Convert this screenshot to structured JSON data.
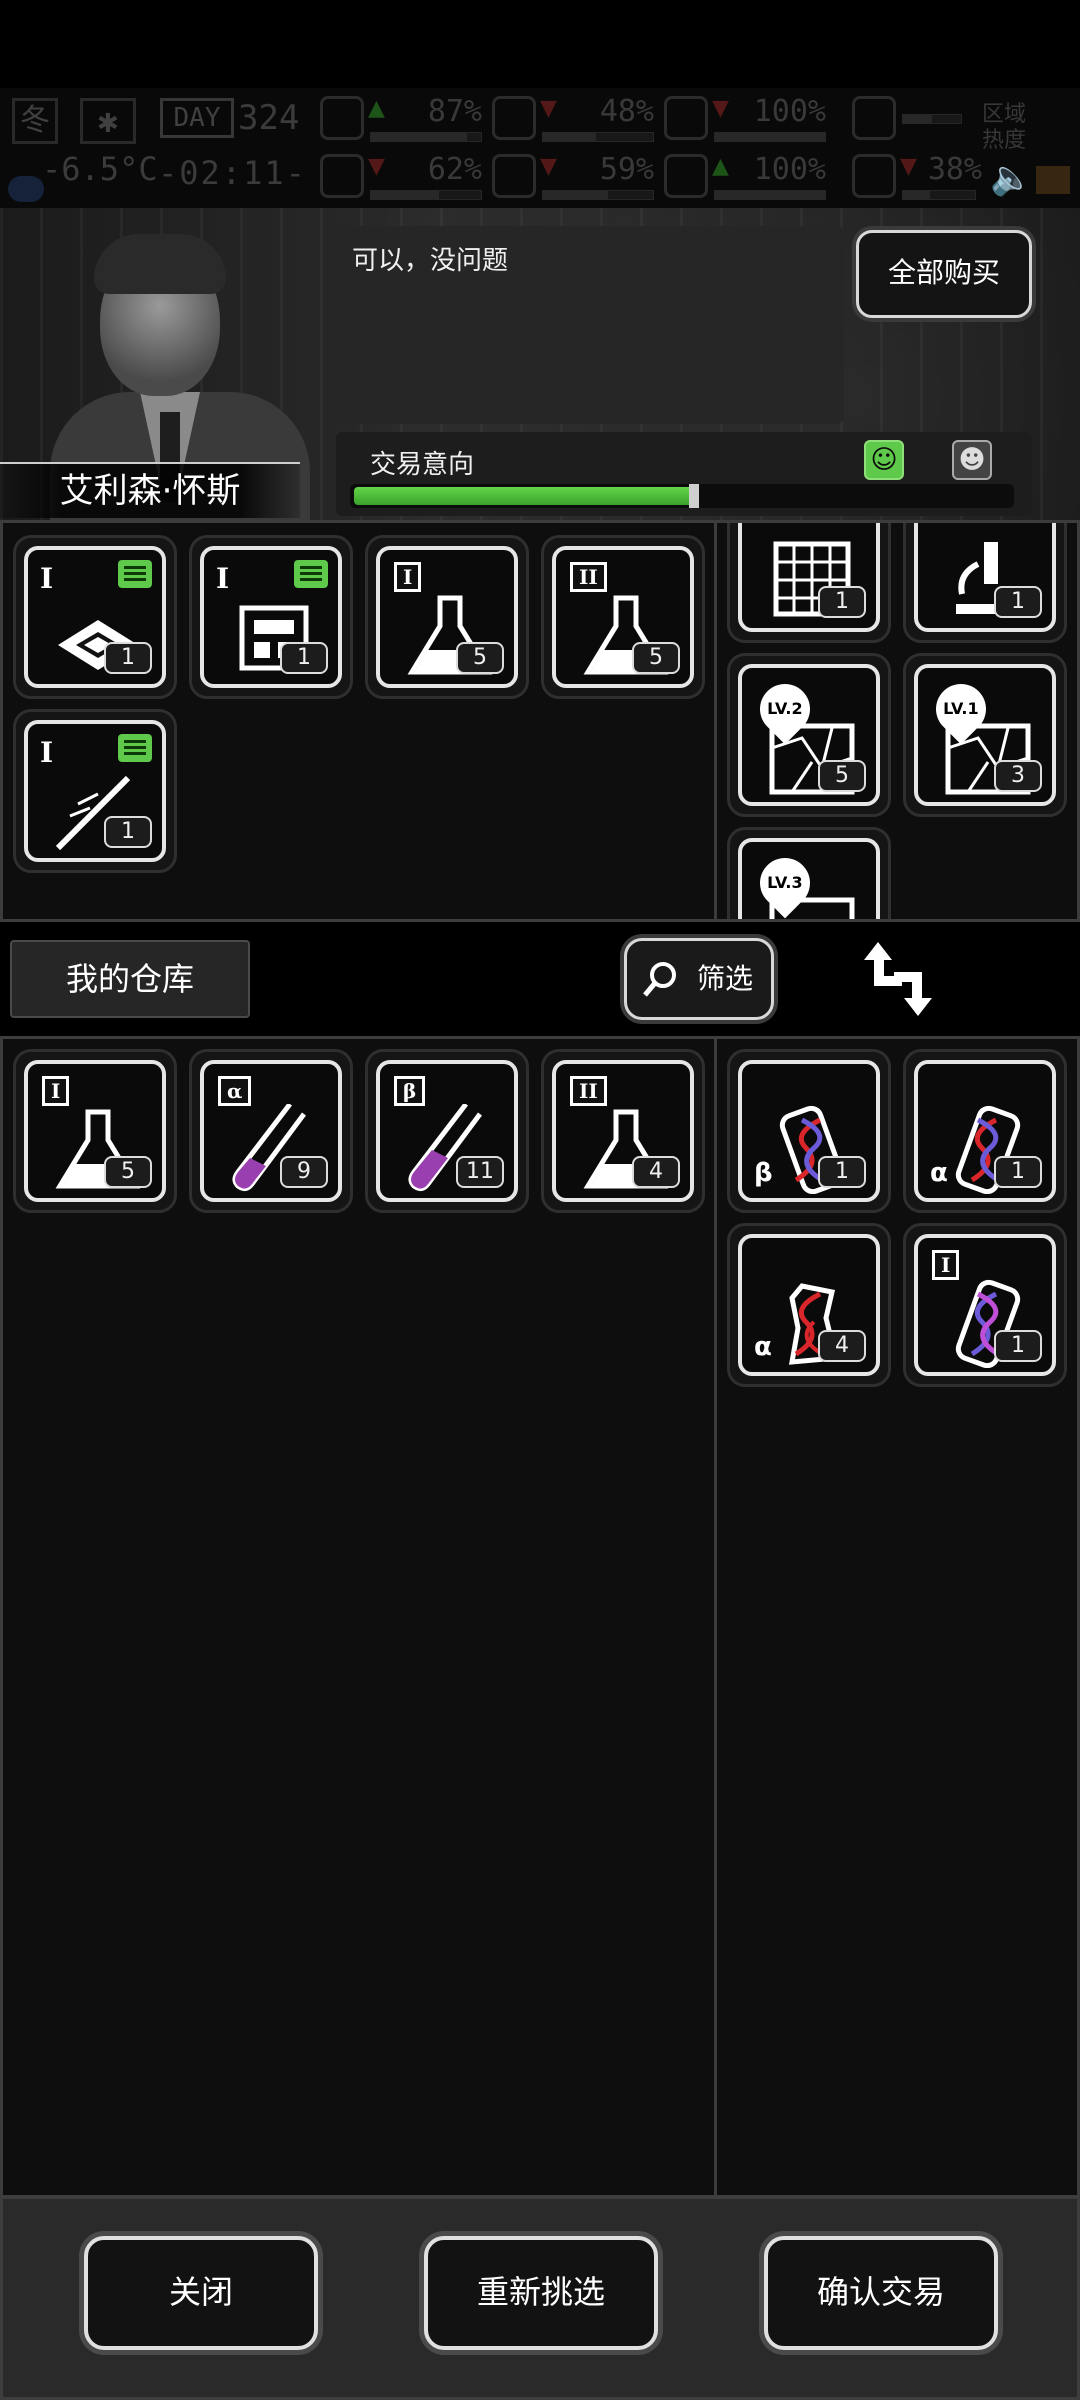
{
  "status": {
    "season": "冬",
    "snow_icon": "snowflake-icon",
    "day_label": "DAY",
    "day_number": "324",
    "temperature": "-6.5°C",
    "time": "-02:11-",
    "stats": [
      {
        "icon": "medkit-icon",
        "value": "87%",
        "trend": "up",
        "level": 0.87
      },
      {
        "icon": "stomach-icon",
        "value": "48%",
        "trend": "down",
        "level": 0.48
      },
      {
        "icon": "energy-icon",
        "value": "100%",
        "trend": "down",
        "level": 1.0
      },
      {
        "icon": "boot-icon",
        "value": "",
        "trend": "none",
        "level": 0.5
      },
      {
        "icon": "brain-icon",
        "value": "62%",
        "trend": "down",
        "level": 0.62
      },
      {
        "icon": "water-drop-icon",
        "value": "59%",
        "trend": "down",
        "level": 0.59
      },
      {
        "icon": "heart-icon",
        "value": "100%",
        "trend": "up",
        "level": 1.0
      },
      {
        "icon": "temperature-icon",
        "value": "38%",
        "trend": "down",
        "level": 0.38
      }
    ],
    "region_label": "区域热度"
  },
  "trader": {
    "name": "艾利森·怀斯",
    "dialogue": "可以，没问题",
    "buy_all_label": "全部购买",
    "intent_label": "交易意向",
    "intent_level": 0.52
  },
  "trader_items": [
    {
      "icon": "cpu-chip-icon",
      "tier": "I",
      "count": "1",
      "tagged": true
    },
    {
      "icon": "circuit-board-icon",
      "tier": "I",
      "count": "1",
      "tagged": true
    },
    {
      "icon": "flask-icon",
      "tier": "I",
      "count": "5",
      "tagged": false
    },
    {
      "icon": "flask-icon",
      "tier": "II",
      "count": "5",
      "tagged": false
    },
    {
      "icon": "syringe-icon",
      "tier": "I",
      "count": "1",
      "tagged": true
    }
  ],
  "offer_items_top": [
    {
      "icon": "grid-map-icon",
      "tier": "",
      "count": "1"
    },
    {
      "icon": "microscope-icon",
      "tier": "",
      "count": "1"
    },
    {
      "icon": "treasure-map-icon",
      "tier": "LV.2",
      "count": "5"
    },
    {
      "icon": "treasure-map-icon",
      "tier": "LV.1",
      "count": "3"
    },
    {
      "icon": "treasure-map-icon",
      "tier": "LV.3",
      "count": ""
    }
  ],
  "warehouse": {
    "label": "我的仓库",
    "filter_label": "筛选"
  },
  "my_items": [
    {
      "icon": "flask-icon",
      "tier": "I",
      "count": "5"
    },
    {
      "icon": "test-tube-icon",
      "tier": "α",
      "count": "9"
    },
    {
      "icon": "test-tube-icon",
      "tier": "β",
      "count": "11"
    },
    {
      "icon": "flask-icon",
      "tier": "II",
      "count": "4"
    }
  ],
  "offer_items_bottom": [
    {
      "icon": "dna-vial-icon",
      "tier": "β",
      "count": "1"
    },
    {
      "icon": "dna-vial-icon",
      "tier": "α",
      "count": "1"
    },
    {
      "icon": "broken-dna-vial-icon",
      "tier": "α",
      "count": "4"
    },
    {
      "icon": "dna-vial-icon",
      "tier": "I",
      "count": "1"
    }
  ],
  "actions": {
    "close": "关闭",
    "reselect": "重新挑选",
    "confirm": "确认交易"
  }
}
